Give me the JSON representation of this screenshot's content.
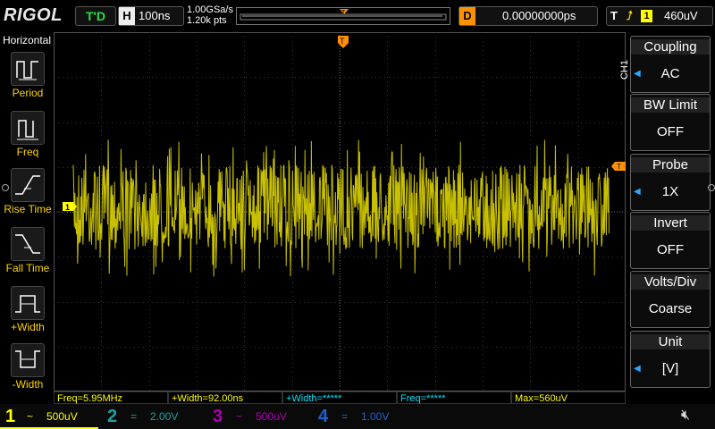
{
  "brand": "RIGOL",
  "run_status": "T'D",
  "horizontal": {
    "label": "H",
    "timebase": "100ns"
  },
  "sampling": {
    "rate": "1.00GSa/s",
    "points": "1.20k pts"
  },
  "trigger_pos_marker": "T",
  "delay": {
    "label": "D",
    "value": "0.00000000ps"
  },
  "trigger": {
    "label": "T",
    "edge_icon": "rising-edge-icon",
    "source": "1",
    "level": "460uV"
  },
  "left_menu": {
    "title": "Horizontal",
    "items": [
      {
        "label": "Period",
        "icon": "period-icon"
      },
      {
        "label": "Freq",
        "icon": "freq-icon"
      },
      {
        "label": "Rise Time",
        "icon": "rise-time-icon"
      },
      {
        "label": "Fall Time",
        "icon": "fall-time-icon"
      },
      {
        "label": "+Width",
        "icon": "pos-width-icon"
      },
      {
        "label": "-Width",
        "icon": "neg-width-icon"
      }
    ]
  },
  "right_menu": {
    "channel": "CH1",
    "items": [
      {
        "title": "Coupling",
        "value": "AC",
        "has_arrow": true
      },
      {
        "title": "BW Limit",
        "value": "OFF",
        "has_arrow": false
      },
      {
        "title": "Probe",
        "value": "1X",
        "has_arrow": true
      },
      {
        "title": "Invert",
        "value": "OFF",
        "has_arrow": false
      },
      {
        "title": "Volts/Div",
        "value": "Coarse",
        "has_arrow": false
      },
      {
        "title": "Unit",
        "value": "[V]",
        "has_arrow": true
      }
    ]
  },
  "ch1_marker": "1",
  "trigger_level_marker": "T",
  "measurements": [
    {
      "text": "Freq=5.95MHz",
      "color": "#ffff00"
    },
    {
      "text": "+Width=92.00ns",
      "color": "#ffff00"
    },
    {
      "text": "+Width=*****",
      "color": "#00e5ff"
    },
    {
      "text": "Freq=*****",
      "color": "#00e5ff"
    },
    {
      "text": "Max=560uV",
      "color": "#ffff00"
    }
  ],
  "channels": [
    {
      "num": "1",
      "coupling": "~",
      "scale": "500uV",
      "color": "#ffff00",
      "active": true
    },
    {
      "num": "2",
      "coupling": "=",
      "scale": "2.00V",
      "color": "#1fa0a0",
      "active": false
    },
    {
      "num": "3",
      "coupling": "~",
      "scale": "500uV",
      "color": "#b000b0",
      "active": false
    },
    {
      "num": "4",
      "coupling": "=",
      "scale": "1.00V",
      "color": "#2060d0",
      "active": false
    }
  ],
  "colors": {
    "trace": "#c8c000",
    "grid": "#3a3a3a",
    "accent_orange": "#ff9000"
  }
}
